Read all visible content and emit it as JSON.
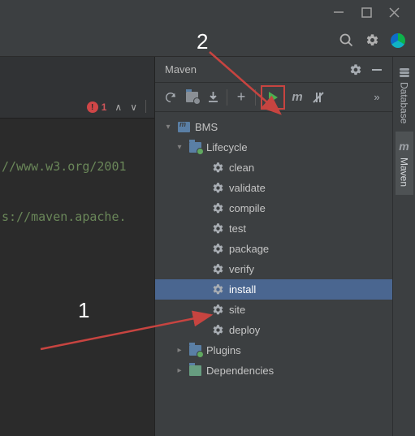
{
  "titlebar": {
    "minimize_icon": "minimize",
    "maximize_icon": "maximize",
    "close_icon": "close"
  },
  "menubar": {
    "search_icon": "search",
    "settings_icon": "gear",
    "profile_icon": "space-badge"
  },
  "editor": {
    "errors_count": "1",
    "code_lines": [
      "//www.w3.org/2001",
      "s://maven.apache."
    ]
  },
  "maven": {
    "title": "Maven",
    "header_gear": "settings",
    "header_min": "minimize",
    "toolbar": {
      "refresh": "refresh",
      "generate": "folder-sync",
      "download": "download",
      "add": "+",
      "run": "run",
      "m": "m",
      "skip": "skip-tests",
      "more": "»"
    },
    "tree": {
      "project": "BMS",
      "lifecycle_label": "Lifecycle",
      "lifecycle": [
        "clean",
        "validate",
        "compile",
        "test",
        "package",
        "verify",
        "install",
        "site",
        "deploy"
      ],
      "selected": "install",
      "plugins_label": "Plugins",
      "dependencies_label": "Dependencies"
    }
  },
  "right_tabs": {
    "database": "Database",
    "maven": "Maven"
  },
  "annotations": {
    "one": "1",
    "two": "2"
  }
}
